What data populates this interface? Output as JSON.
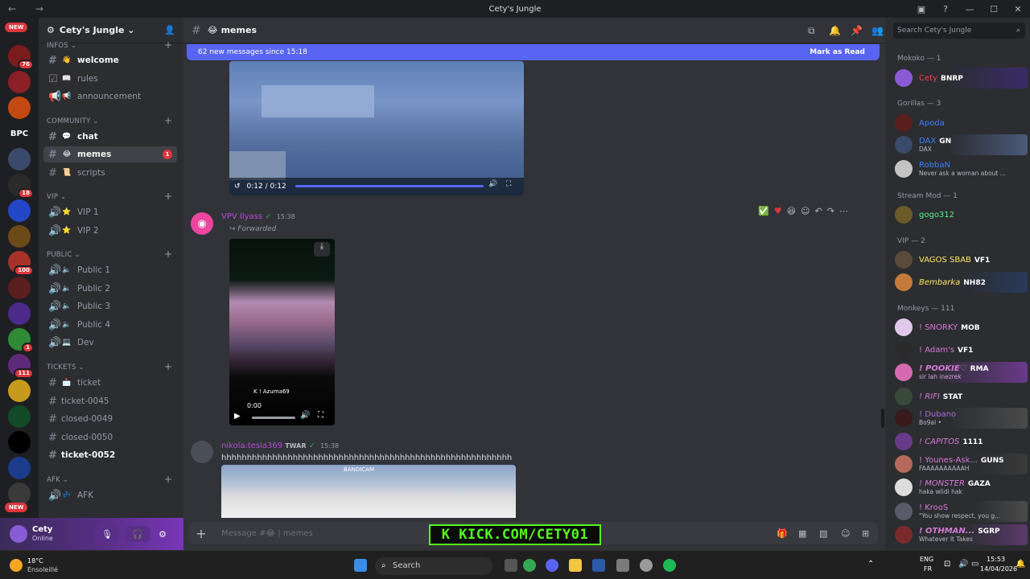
{
  "window": {
    "title": "Cety's Jungle",
    "back": "←",
    "forward": "→"
  },
  "rail": {
    "new_top": "NEW",
    "new_bottom": "NEW",
    "bpc": "BPC",
    "badges": [
      "76",
      "18",
      "1",
      "100",
      "1",
      "111"
    ]
  },
  "server": {
    "name": "Cety's Jungle ⌄"
  },
  "categories": {
    "infos": "INFOS ⌄",
    "community": "COMMUNITY ⌄",
    "vip": "VIP ⌄",
    "public": "PUBLIC ⌄",
    "tickets": "TICKETS ⌄",
    "afk": "AFK ⌄"
  },
  "channels": {
    "welcome": "welcome",
    "rules": "rules",
    "announcement": "announcement",
    "chat": "chat",
    "memes": "memes",
    "memes_count": "1",
    "scripts": "scripts",
    "vip1": "VIP 1",
    "vip2": "VIP 2",
    "public1": "Public 1",
    "public2": "Public 2",
    "public3": "Public 3",
    "public4": "Public 4",
    "dev": "Dev",
    "ticket": "ticket",
    "ticket0045": "ticket-0045",
    "closed0049": "closed-0049",
    "closed0050": "closed-0050",
    "ticket0052": "ticket-0052",
    "afk": "AFK"
  },
  "user": {
    "name": "Cety",
    "status": "Online"
  },
  "header": {
    "channel": "memes"
  },
  "newbar": {
    "text": "62 new messages since 15:18",
    "mark": "Mark as Read"
  },
  "video1": {
    "time": "0:12 / 0:12"
  },
  "msg1": {
    "author": "VPV Ilyass",
    "time": "15:38",
    "forwarded": "Forwarded",
    "video_time": "0:00",
    "overlay": "K ! Azuma69"
  },
  "msg2": {
    "author": "nikola.tesla369",
    "tag": "TWAR",
    "time": "15:38",
    "text": "hhhhhhhhhhhhhhhhhhhhhhhhhhhhhhhhhhhhhhhhhhhhhhhhhhhhhhhhh",
    "overlay": "BANDICAM"
  },
  "composer": {
    "placeholder": "Message #😂 | memes"
  },
  "kick": {
    "text": "K KICK.COM/CETY01"
  },
  "search": {
    "placeholder": "Search Cety's Jungle"
  },
  "members": {
    "cat_mokoko": "Mokoko — 1",
    "cat_gorillas": "Gorillas — 3",
    "cat_stream": "Stream Mod — 1",
    "cat_vip": "VIP — 2",
    "cat_monkeys": "Monkeys — 111",
    "list": [
      {
        "name": "Cety",
        "tag": "BNRP",
        "status": ""
      },
      {
        "name": "Apoda",
        "tag": "",
        "status": ""
      },
      {
        "name": "DAX",
        "tag": "GN",
        "status": "DAX"
      },
      {
        "name": "RobbaN",
        "tag": "",
        "status": "Never ask a woman about ..."
      },
      {
        "name": "gogo312",
        "tag": "",
        "status": ""
      },
      {
        "name": "VAGOS SBAB",
        "tag": "VF1",
        "status": ""
      },
      {
        "name": "Bembarka",
        "tag": "NH82",
        "status": ""
      },
      {
        "name": "! SNORKY",
        "tag": "MOB",
        "status": ""
      },
      {
        "name": "! Adam's",
        "tag": "VF1",
        "status": ""
      },
      {
        "name": "! POOKIE♡",
        "tag": "RMA",
        "status": "sir lah inezrek"
      },
      {
        "name": "! RIFI",
        "tag": "STAT",
        "status": ""
      },
      {
        "name": "! Dubano",
        "tag": "",
        "status": "Bo9al •"
      },
      {
        "name": "! CAPITOS",
        "tag": "1111",
        "status": ""
      },
      {
        "name": "! Younes-Ask...",
        "tag": "GUNS",
        "status": "FAAAAAAAAAAH"
      },
      {
        "name": "! MONSTER",
        "tag": "GAZA",
        "status": "haka wlidi hak"
      },
      {
        "name": "! KrooS",
        "tag": "",
        "status": "\"You show respect, you g..."
      },
      {
        "name": "! OTHMAN...",
        "tag": "SGRP",
        "status": "Whatever It Takes"
      }
    ]
  },
  "taskbar": {
    "weather": "18°C",
    "weather_desc": "Ensoleillé",
    "search": "Search",
    "lang": "ENG",
    "lang2": "FR",
    "time": "15:53",
    "date": "14/04/2026"
  },
  "colors": {
    "accent": "#5865f2",
    "kick": "#53fc18",
    "unread_badge": "#da373c"
  }
}
